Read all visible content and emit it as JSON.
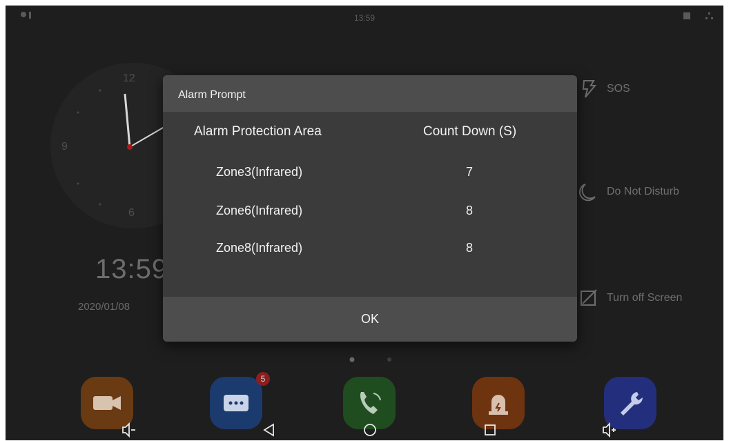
{
  "status_bar": {
    "time": "13:59"
  },
  "clock": {
    "numerals": {
      "twelve": "12",
      "nine": "9",
      "six": "6"
    }
  },
  "home": {
    "time": "13:59",
    "date": "2020/01/08"
  },
  "right_menu": [
    {
      "label": "SOS",
      "icon": "sos-icon"
    },
    {
      "label": "Do Not Disturb",
      "icon": "moon-icon"
    },
    {
      "label": "Turn off Screen",
      "icon": "screen-off-icon"
    }
  ],
  "dock": {
    "apps": [
      {
        "icon": "camera-icon",
        "color": "#c56a1a"
      },
      {
        "icon": "message-icon",
        "color": "#2b67c4"
      },
      {
        "icon": "call-icon",
        "color": "#2f8a2f"
      },
      {
        "icon": "alarm-icon",
        "color": "#c85b1c"
      },
      {
        "icon": "wrench-icon",
        "color": "#3a4fd0"
      }
    ],
    "message_badge": "5"
  },
  "nav_bar": [
    "volume-down-icon",
    "back-icon",
    "home-icon",
    "recents-icon",
    "volume-up-icon"
  ],
  "dialog": {
    "title": "Alarm Prompt",
    "col_area": "Alarm Protection Area",
    "col_countdown": "Count Down (S)",
    "rows": [
      {
        "zone": "Zone3(Infrared)",
        "countdown": "7"
      },
      {
        "zone": "Zone6(Infrared)",
        "countdown": "8"
      },
      {
        "zone": "Zone8(Infrared)",
        "countdown": "8"
      }
    ],
    "ok_label": "OK"
  }
}
